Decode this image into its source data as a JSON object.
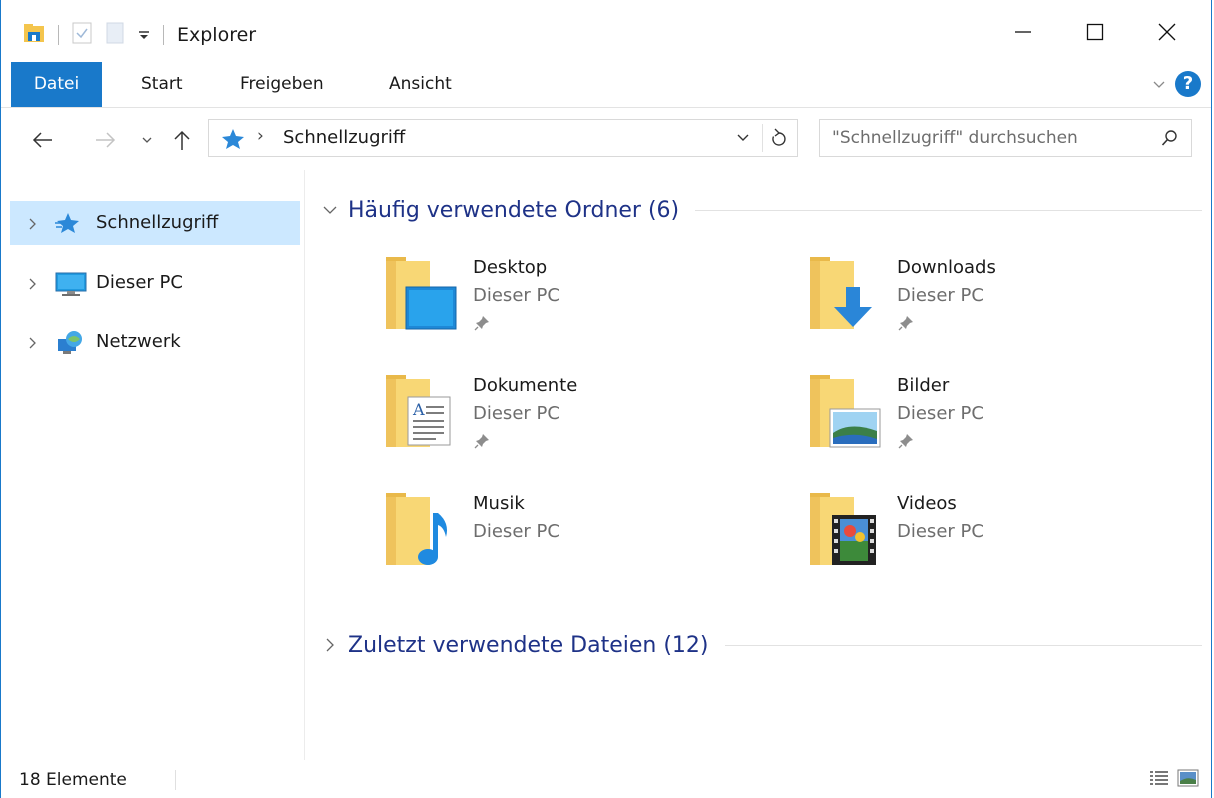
{
  "window": {
    "title": "Explorer"
  },
  "ribbon": {
    "tabs": [
      {
        "label": "Datei",
        "active": true
      },
      {
        "label": "Start"
      },
      {
        "label": "Freigeben"
      },
      {
        "label": "Ansicht"
      }
    ],
    "help_label": "?"
  },
  "address": {
    "separator": "›",
    "current": "Schnellzugriff"
  },
  "search": {
    "placeholder": "\"Schnellzugriff\" durchsuchen"
  },
  "navpane": {
    "items": [
      {
        "label": "Schnellzugriff",
        "icon": "quick-access-star-icon",
        "selected": true
      },
      {
        "label": "Dieser PC",
        "icon": "computer-icon"
      },
      {
        "label": "Netzwerk",
        "icon": "network-icon"
      }
    ]
  },
  "groups": {
    "frequent": {
      "title": "Häufig verwendete Ordner (6)",
      "folders": [
        {
          "name": "Desktop",
          "location": "Dieser PC",
          "pinned": true,
          "icon": "desktop-folder-icon"
        },
        {
          "name": "Downloads",
          "location": "Dieser PC",
          "pinned": true,
          "icon": "downloads-folder-icon"
        },
        {
          "name": "Dokumente",
          "location": "Dieser PC",
          "pinned": true,
          "icon": "documents-folder-icon"
        },
        {
          "name": "Bilder",
          "location": "Dieser PC",
          "pinned": true,
          "icon": "pictures-folder-icon"
        },
        {
          "name": "Musik",
          "location": "Dieser PC",
          "pinned": false,
          "icon": "music-folder-icon"
        },
        {
          "name": "Videos",
          "location": "Dieser PC",
          "pinned": false,
          "icon": "videos-folder-icon"
        }
      ]
    },
    "recent": {
      "title": "Zuletzt verwendete Dateien (12)"
    }
  },
  "statusbar": {
    "count": "18 Elemente"
  },
  "colors": {
    "accent": "#1979ca",
    "selection": "#cce8ff",
    "group_header": "#1e3287",
    "folder": "#f8d775"
  }
}
